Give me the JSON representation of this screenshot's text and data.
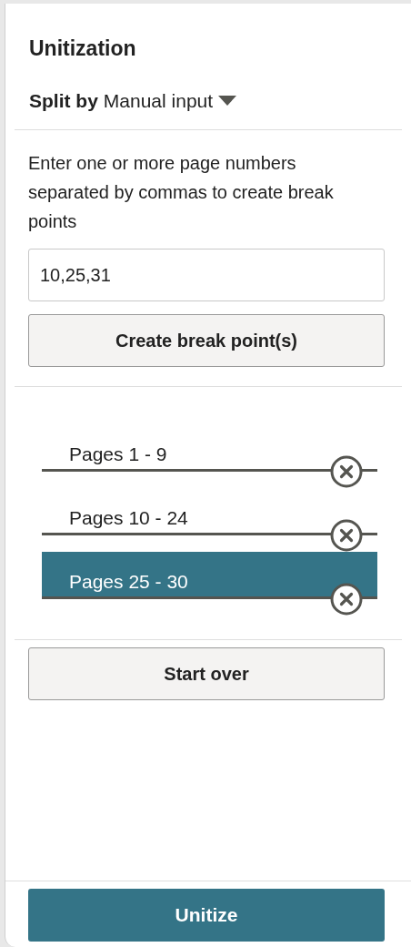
{
  "panel": {
    "title": "Unitization"
  },
  "split_by": {
    "label": "Split by",
    "value": "Manual input"
  },
  "instructions": "Enter one or more page numbers separated by commas to create break points",
  "break_input": {
    "value": "10,25,31"
  },
  "create_button": "Create break point(s)",
  "ranges": [
    {
      "label": "Pages 1 - 9",
      "selected": false
    },
    {
      "label": "Pages 10 - 24",
      "selected": false
    },
    {
      "label": "Pages 25 - 30",
      "selected": true
    }
  ],
  "start_over_button": "Start over",
  "unitize_button": "Unitize"
}
